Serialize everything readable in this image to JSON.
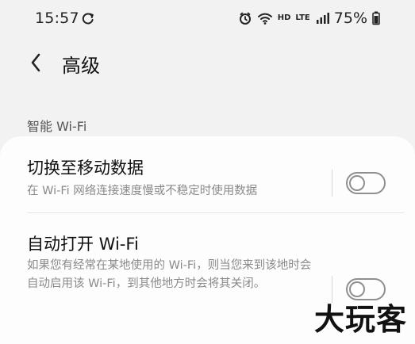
{
  "status_bar": {
    "time": "15:57",
    "hd_label": "HD",
    "lte_label": "LTE",
    "battery": "75%"
  },
  "header": {
    "title": "高级"
  },
  "section": {
    "title": "智能 Wi-Fi"
  },
  "items": [
    {
      "title": "切换至移动数据",
      "description": "在 Wi-Fi 网络连接速度慢或不稳定时使用数据",
      "enabled": false
    },
    {
      "title": "自动打开 Wi-Fi",
      "description": "如果您有经常在某地使用的 Wi-Fi，则当您来到该地时会自动启用该 Wi-Fi，到其他地方时会将其关闭。",
      "enabled": false
    }
  ],
  "watermark": "大玩客",
  "colors": {
    "background": "#f2f2f2",
    "card": "#fdfdfd",
    "secondary_text": "#8a8a8a",
    "switch_border": "#8f8f8f"
  },
  "icons": {
    "sync": "sync-icon",
    "alarm": "alarm-icon",
    "wifi": "wifi-icon",
    "signal": "signal-icon",
    "battery": "battery-icon",
    "back": "chevron-left-icon"
  }
}
